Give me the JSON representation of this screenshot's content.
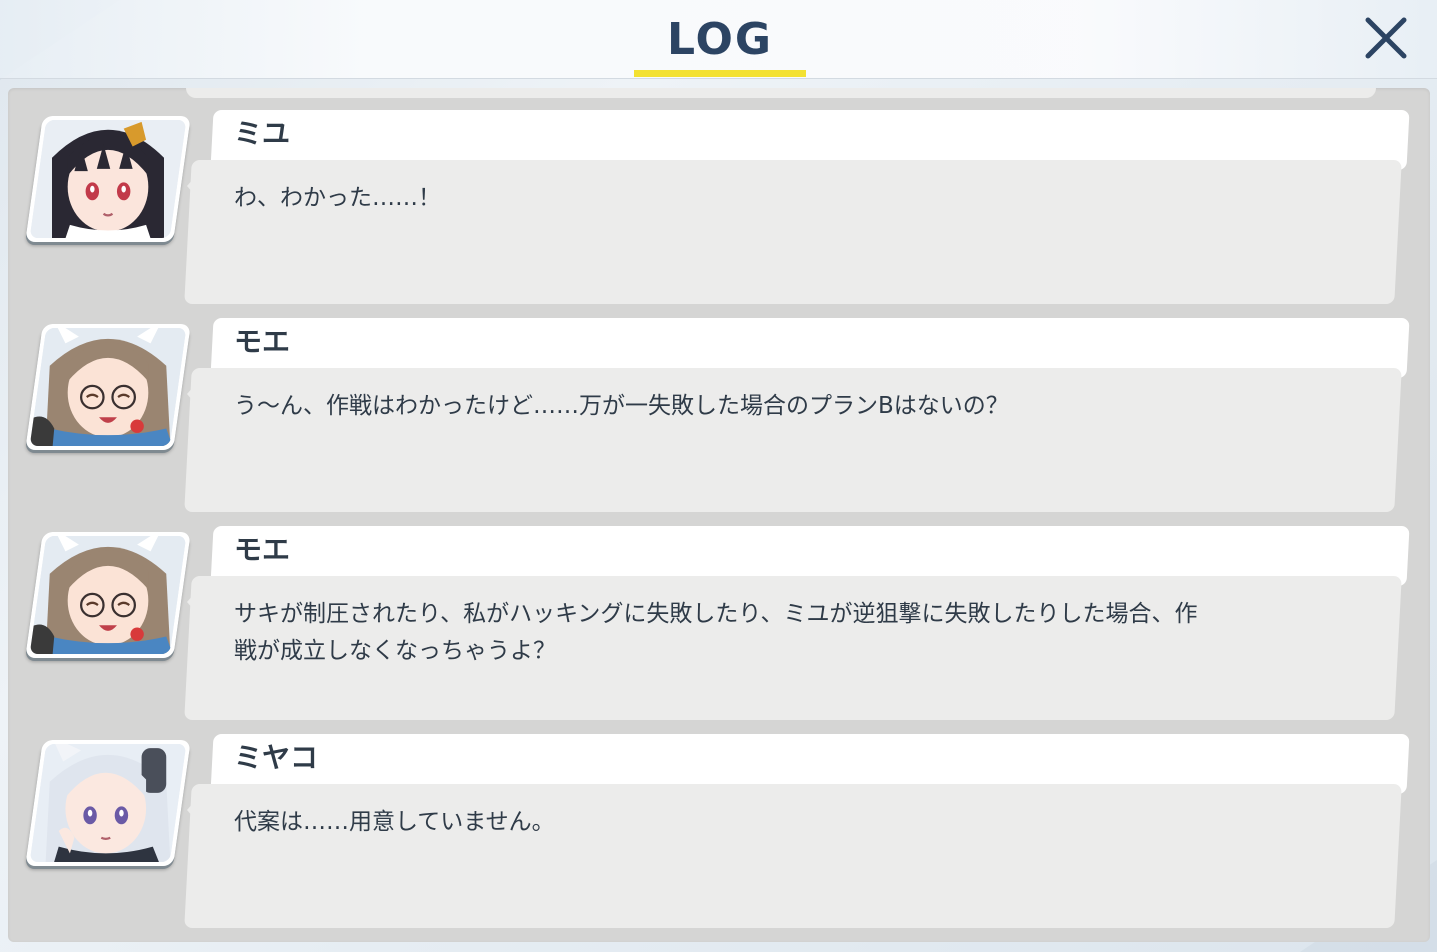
{
  "header": {
    "title": "LOG",
    "accent_color": "#f3e132",
    "close_icon": "close-icon"
  },
  "log": [
    {
      "speaker": "ミユ",
      "avatar": "miyu-portrait",
      "message": "わ、わかった……！"
    },
    {
      "speaker": "モエ",
      "avatar": "moe-portrait",
      "message": "う～ん、作戦はわかったけど……万が一失敗した場合のプランBはないの？"
    },
    {
      "speaker": "モエ",
      "avatar": "moe-portrait",
      "message": "サキが制圧されたり、私がハッキングに失敗したり、ミユが逆狙撃に失敗したりした場合、作\n戦が成立しなくなっちゃうよ？"
    },
    {
      "speaker": "ミヤコ",
      "avatar": "miyako-portrait",
      "message": "代案は……用意していません。"
    }
  ]
}
